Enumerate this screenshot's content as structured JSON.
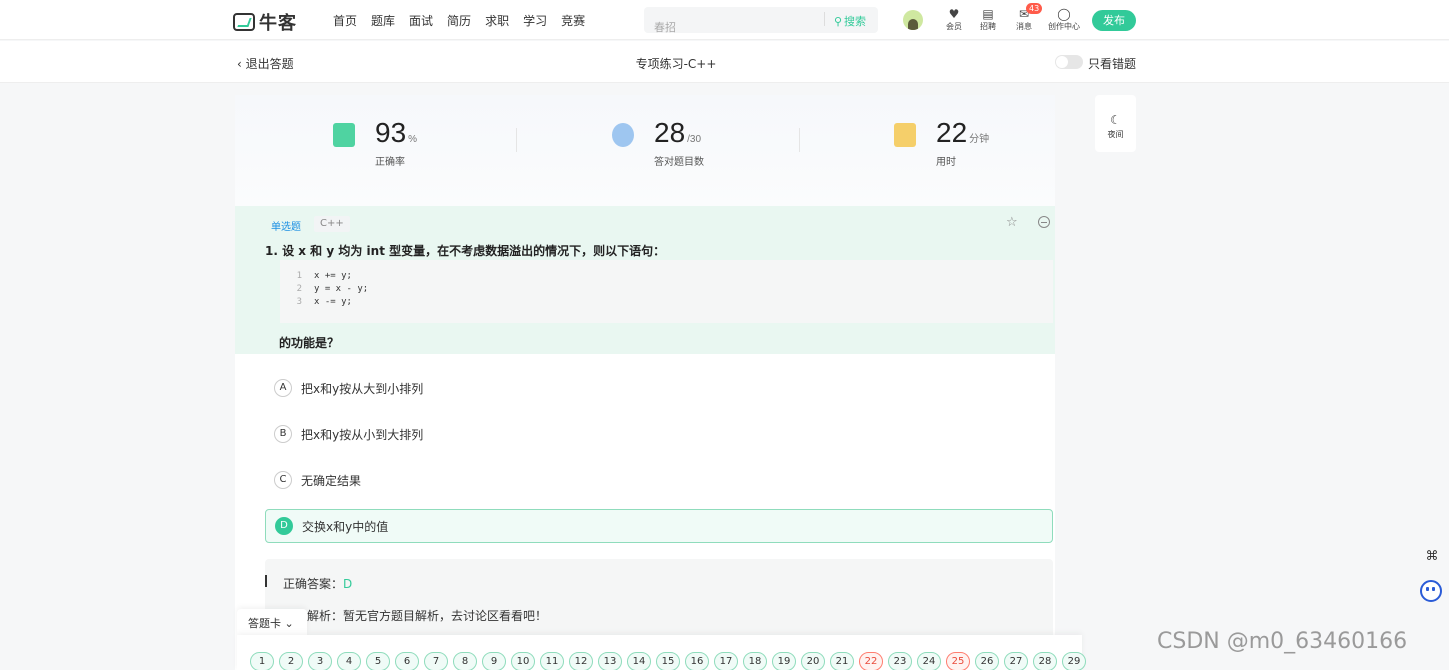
{
  "header": {
    "logo_text": "牛客",
    "nav": [
      "首页",
      "题库",
      "面试",
      "简历",
      "求职",
      "学习",
      "竞赛"
    ],
    "search": {
      "placeholder": "春招",
      "button": "搜索"
    },
    "icons": [
      {
        "name": "member-icon",
        "label": "会员"
      },
      {
        "name": "recruit-icon",
        "label": "招聘"
      },
      {
        "name": "message-icon",
        "label": "消息"
      },
      {
        "name": "creator-icon",
        "label": "创作中心"
      }
    ],
    "message_badge": "43",
    "publish": "发布"
  },
  "subbar": {
    "exit": "退出答题",
    "title": "专项练习-C++",
    "toggle_label": "只看错题",
    "toggle_on": false
  },
  "stats": {
    "accuracy": {
      "value": "93",
      "unit": "%",
      "label": "正确率"
    },
    "correct": {
      "value": "28",
      "unit": "/30",
      "label": "答对题目数"
    },
    "time": {
      "value": "22",
      "unit": "分钟",
      "label": "用时"
    }
  },
  "question": {
    "type": "单选题",
    "tag": "C++",
    "title": "1. 设 x 和 y 均为 int 型变量，在不考虑数据溢出的情况下，则以下语句：",
    "code": [
      {
        "n": "1",
        "t": "x += y;"
      },
      {
        "n": "2",
        "t": "y = x - y;"
      },
      {
        "n": "3",
        "t": "x -= y;"
      }
    ],
    "tail": "的功能是？",
    "options": [
      {
        "key": "A",
        "text": "把x和y按从大到小排列",
        "selected": false
      },
      {
        "key": "B",
        "text": "把x和y按从小到大排列",
        "selected": false
      },
      {
        "key": "C",
        "text": "无确定结果",
        "selected": false
      },
      {
        "key": "D",
        "text": "交换x和y中的值",
        "selected": true
      }
    ]
  },
  "answer": {
    "label": "正确答案：",
    "value": "D",
    "analysis": "解析：暂无官方题目解析，去讨论区看看吧！"
  },
  "night": {
    "label": "夜间"
  },
  "answer_card": {
    "tab": "答题卡",
    "numbers": [
      "1",
      "2",
      "3",
      "4",
      "5",
      "6",
      "7",
      "8",
      "9",
      "10",
      "11",
      "12",
      "13",
      "14",
      "15",
      "16",
      "17",
      "18",
      "19",
      "20",
      "21",
      "22",
      "23",
      "24",
      "25",
      "26",
      "27",
      "28",
      "29"
    ],
    "wrong": [
      "22",
      "25"
    ]
  },
  "watermark": "CSDN @m0_63460166",
  "colors": {
    "accent": "#32ca99",
    "wrong": "#e94b3b",
    "link": "#1a8fe3"
  }
}
